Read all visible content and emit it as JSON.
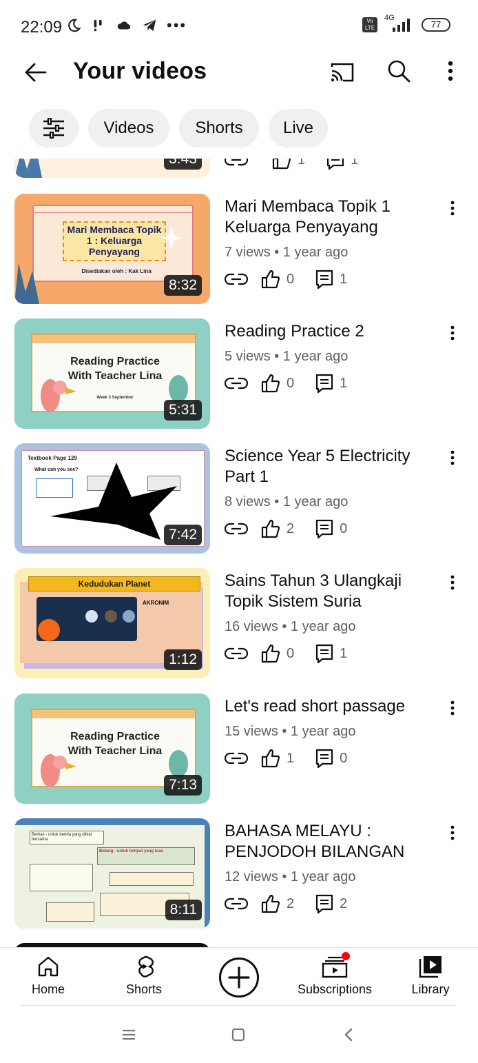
{
  "status_bar": {
    "time": "22:09",
    "network": "4G",
    "volte": "Vo LTE",
    "battery": "77"
  },
  "header": {
    "title": "Your videos",
    "icons": [
      "back-arrow-icon",
      "cast-icon",
      "search-icon",
      "more-vert-icon"
    ]
  },
  "chips": {
    "filter_icon": "tune-icon",
    "items": [
      "Videos",
      "Shorts",
      "Live"
    ]
  },
  "partial_top_item": {
    "duration": "3:43",
    "likes": "1",
    "comments": "1"
  },
  "videos": [
    {
      "title": "Mari Membaca Topik 1 Keluarga Penyayang",
      "meta": "7 views • 1 year ago",
      "duration": "8:32",
      "likes": "0",
      "comments": "1",
      "thumb_text": "Mari Membaca Topik 1 : Keluarga Penyayang",
      "thumb_sub": "Disediakan oleh : Kak Lina"
    },
    {
      "title": "Reading Practice 2",
      "meta": "5 views • 1 year ago",
      "duration": "5:31",
      "likes": "0",
      "comments": "1",
      "thumb_text": "Reading Practice With Teacher Lina",
      "thumb_sub": "Week 3 September"
    },
    {
      "title": "Science Year 5 Electricity Part 1",
      "meta": "8 views • 1 year ago",
      "duration": "7:42",
      "likes": "2",
      "comments": "0",
      "thumb_text": "Textbook Page 129",
      "thumb_sub": "What can you see?"
    },
    {
      "title": "Sains Tahun 3 Ulangkaji Topik Sistem Suria",
      "meta": "16 views • 1 year ago",
      "duration": "1:12",
      "likes": "0",
      "comments": "1",
      "thumb_text": "Kedudukan Planet",
      "thumb_sub": "AKRONIM"
    },
    {
      "title": "Let's read short passage",
      "meta": "15 views • 1 year ago",
      "duration": "7:13",
      "likes": "1",
      "comments": "0",
      "thumb_text": "Reading Practice With Teacher Lina",
      "thumb_sub": ""
    },
    {
      "title": "BAHASA MELAYU : PENJODOH BILANGAN",
      "meta": "12 views • 1 year ago",
      "duration": "8:11",
      "likes": "2",
      "comments": "2",
      "thumb_text": "Berkas - untuk benda yang diikat bersama",
      "thumb_sub": "Bidang - untuk tempat yang luas"
    }
  ],
  "bottom_nav": {
    "home": "Home",
    "shorts": "Shorts",
    "subscriptions": "Subscriptions",
    "library": "Library"
  },
  "colors": {
    "accent_red": "#ff0000",
    "text_primary": "#0f0f0f",
    "text_secondary": "#606060",
    "chip_bg": "#f0f0f0"
  }
}
